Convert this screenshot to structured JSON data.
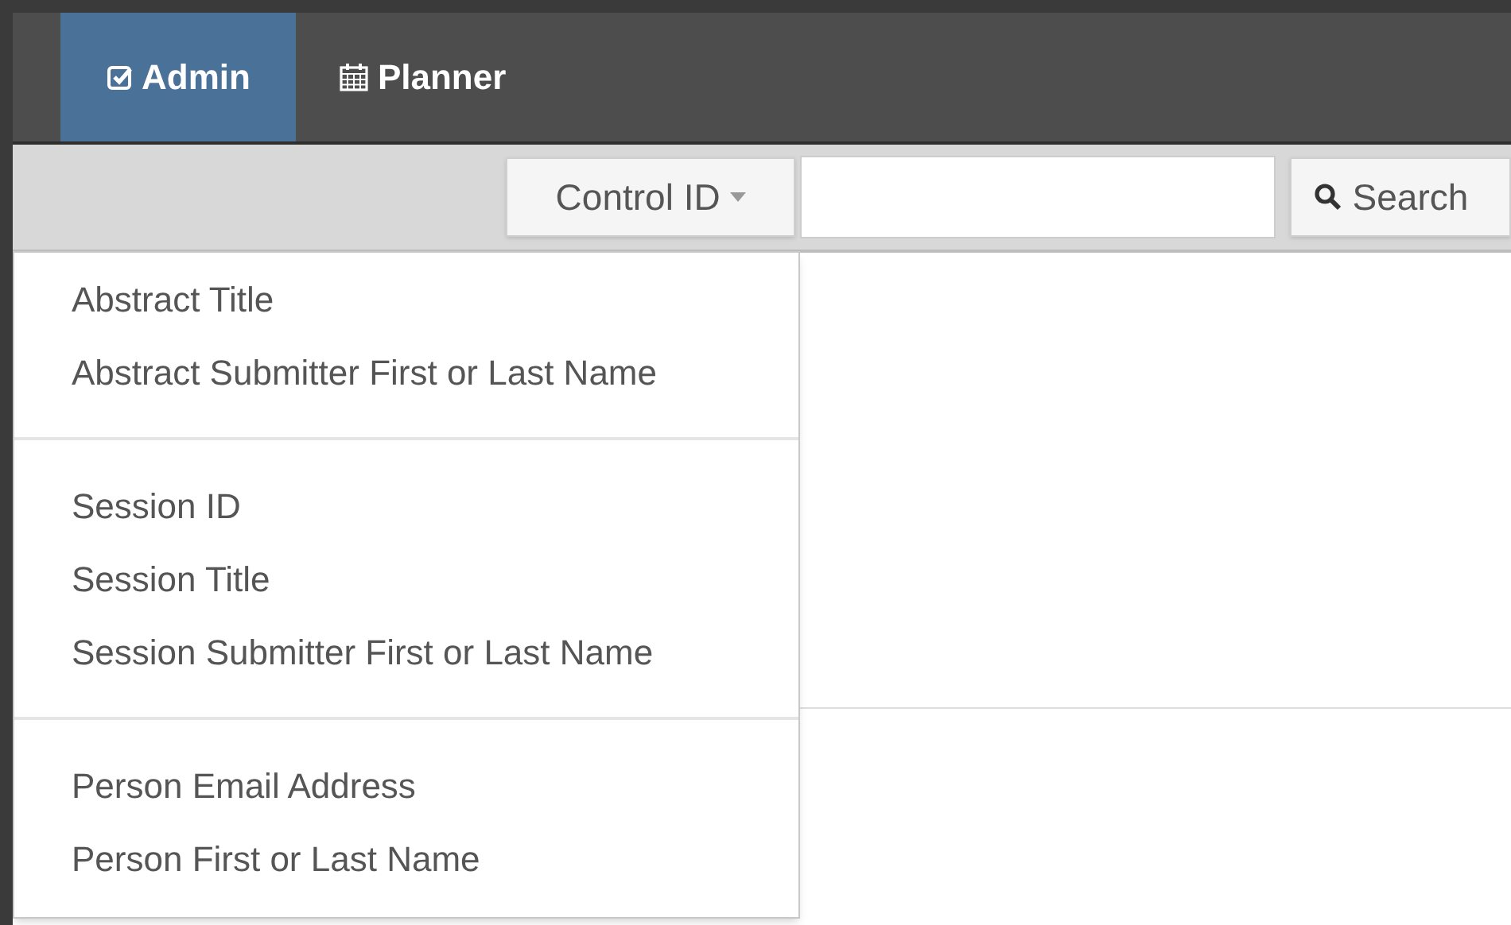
{
  "nav": {
    "tabs": [
      {
        "label": "Admin",
        "kind": "check",
        "selected": true
      },
      {
        "label": "Planner",
        "kind": "calendar",
        "selected": false
      }
    ]
  },
  "search": {
    "field_button": "Control ID",
    "button": "Search"
  },
  "menu": {
    "groups": [
      [
        "Abstract Title",
        "Abstract Submitter First or Last Name"
      ],
      [
        "Session ID",
        "Session Title",
        "Session Submitter First or Last Name"
      ],
      [
        "Person Email Address",
        "Person First or Last Name"
      ]
    ]
  }
}
